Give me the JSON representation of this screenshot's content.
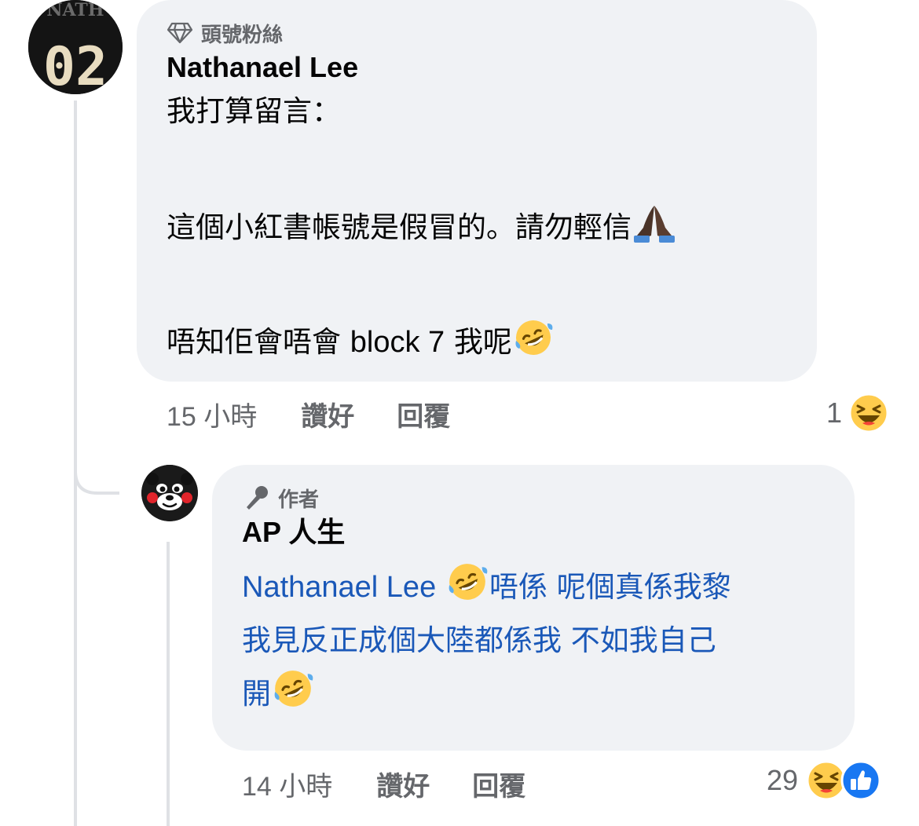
{
  "comment": {
    "badge_label": "頭號粉絲",
    "badge_icon": "diamond-icon",
    "author": "Nathanael Lee",
    "avatar_jersey_top": "NATH",
    "avatar_jersey_number": "02",
    "line1": "我打算留言：",
    "line2_text": "這個小紅書帳號是假冒的。請勿輕信",
    "line2_emoji": "folded-hands-emoji",
    "line3_text1": "唔知佢會唔會 ",
    "line3_latin": "block 7",
    "line3_text2": "我呢",
    "line3_emoji": "rofl-emoji",
    "time": "15 小時",
    "like_label": "讚好",
    "reply_label": "回覆",
    "reaction_count": "1",
    "reaction_type": "haha-emoji"
  },
  "reply": {
    "badge_label": "作者",
    "badge_icon": "microphone-icon",
    "author": "AP 人生",
    "avatar_icon": "kumamon-avatar",
    "mention": "Nathanael Lee",
    "line1_text": "唔係 呢個真係我黎",
    "line2_text": "我見反正成個大陸都係我 不如我自己",
    "line3_text": "開",
    "time": "14 小時",
    "like_label": "讚好",
    "reply_label": "回覆",
    "reaction_count": "29",
    "reaction_types": [
      "haha-emoji",
      "like-emoji"
    ]
  },
  "colors": {
    "bubble": "#f0f2f5",
    "mention": "#1a58b8",
    "meta": "#65676b",
    "like_blue": "#1877f2",
    "emoji_yellow": "#ffcc4d"
  }
}
